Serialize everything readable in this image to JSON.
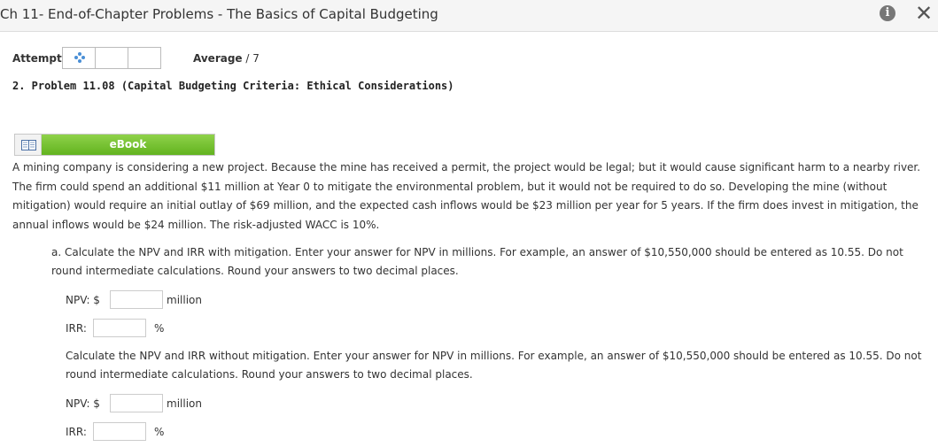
{
  "header": {
    "title": "Ch 11- End-of-Chapter Problems - The Basics of Capital Budgeting",
    "info_icon": "info-icon",
    "close_icon": "close-icon",
    "close_glyph": "✕",
    "info_glyph": "i"
  },
  "attempts": {
    "label": "Attempts",
    "average_label": "Average",
    "average_value": "/ 7"
  },
  "problem": {
    "title": "2.  Problem 11.08 (Capital Budgeting Criteria: Ethical Considerations)",
    "ebook_label": "eBook",
    "description": "A mining company is considering a new project. Because the mine has received a permit, the project would be legal; but it would cause significant harm to a nearby river. The firm could spend an additional $11 million at Year 0 to mitigate the environmental problem, but it would not be required to do so. Developing the mine (without mitigation) would require an initial outlay of $69 million, and the expected cash inflows would be $23 million per year for 5 years. If the firm does invest in mitigation, the annual inflows would be $24 million. The risk-adjusted WACC is 10%."
  },
  "part_a": {
    "marker": "a.",
    "text": "Calculate the NPV and IRR with mitigation. Enter your answer for NPV in millions. For example, an answer of $10,550,000 should be entered as 10.55. Do not round intermediate calculations. Round your answers to two decimal places.",
    "npv_label": "NPV: $",
    "npv_value": "",
    "npv_unit": "million",
    "irr_label": "IRR:",
    "irr_value": "",
    "irr_unit": "%"
  },
  "part_b": {
    "text": "Calculate the NPV and IRR without mitigation. Enter your answer for NPV in millions. For example, an answer of $10,550,000 should be entered as 10.55. Do not round intermediate calculations. Round your answers to two decimal places.",
    "npv_label": "NPV: $",
    "npv_value": "",
    "npv_unit": "million",
    "irr_label": "IRR:",
    "irr_value": "",
    "irr_unit": "%"
  },
  "colors": {
    "ebook_green": "#7cc63a",
    "loading_blue": "#4a8fd6"
  }
}
